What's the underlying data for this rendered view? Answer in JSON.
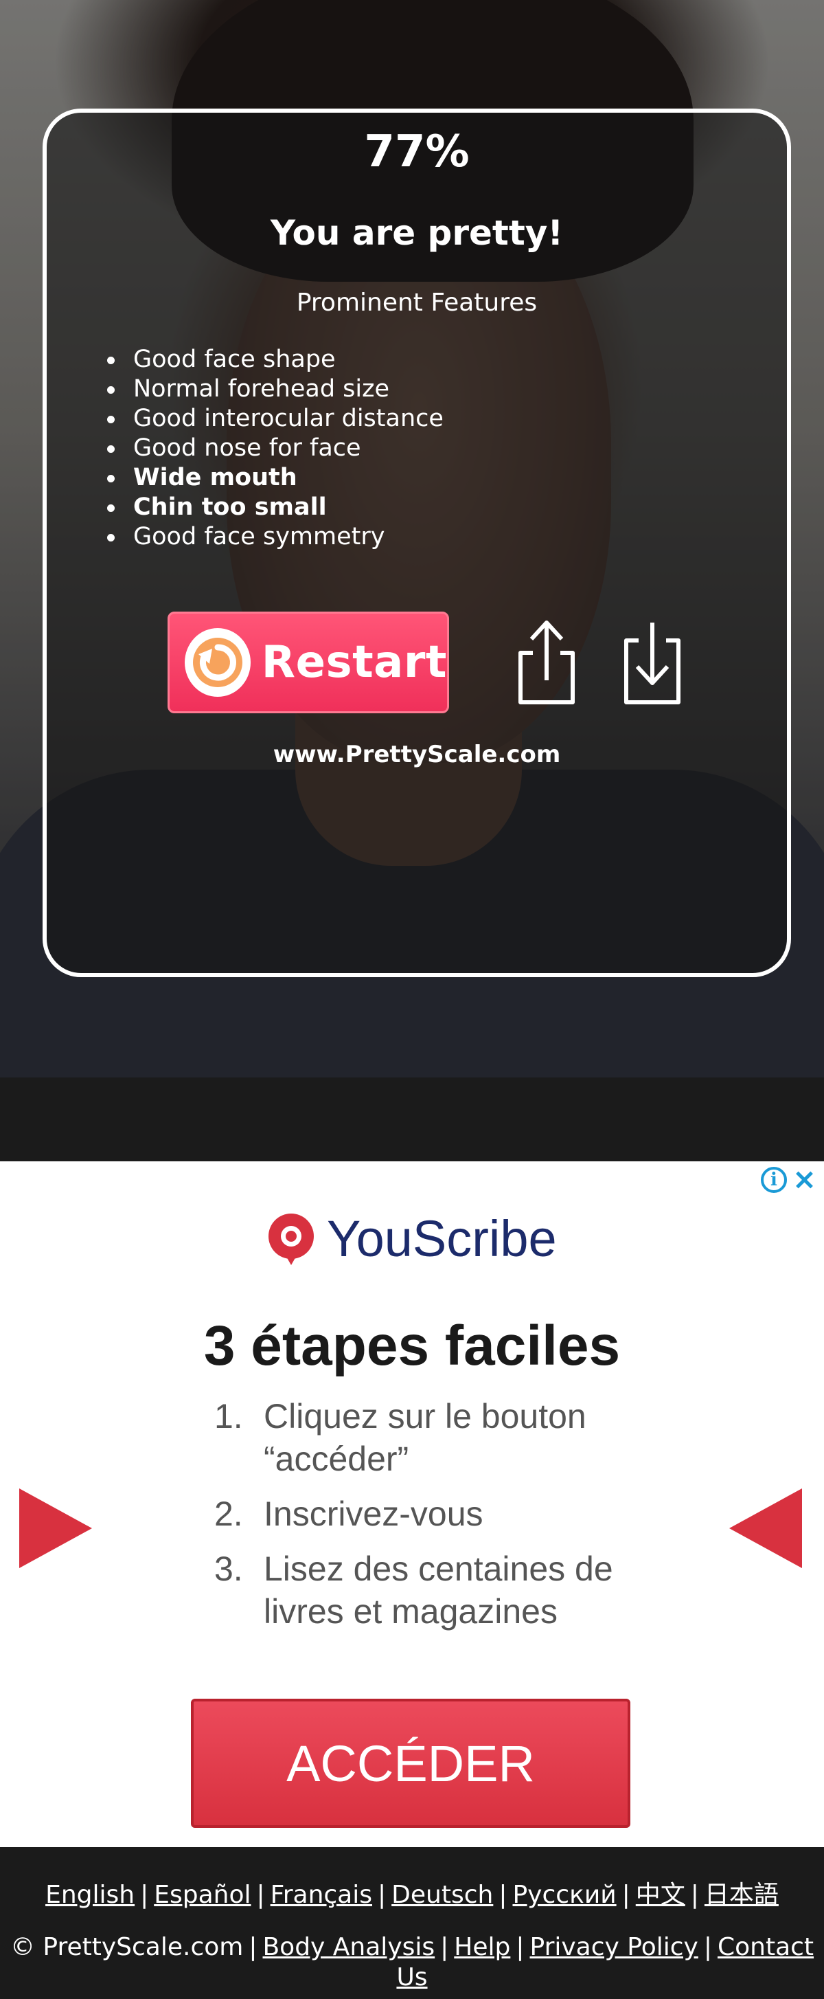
{
  "result": {
    "score": "77%",
    "verdict": "You are pretty!",
    "features_title": "Prominent Features",
    "features": [
      {
        "text": "Good face shape",
        "bold": false
      },
      {
        "text": "Normal forehead size",
        "bold": false
      },
      {
        "text": "Good interocular distance",
        "bold": false
      },
      {
        "text": "Good nose for face",
        "bold": false
      },
      {
        "text": "Wide mouth",
        "bold": true
      },
      {
        "text": "Chin too small",
        "bold": true
      },
      {
        "text": "Good face symmetry",
        "bold": false
      }
    ],
    "restart_label": "Restart",
    "share_icon": "share-icon",
    "download_icon": "download-icon",
    "site": "www.PrettyScale.com"
  },
  "ad": {
    "brand": "YouScribe",
    "headline": "3 étapes faciles",
    "steps": [
      {
        "num": "1.",
        "text": "Cliquez sur le bouton “accéder”"
      },
      {
        "num": "2.",
        "text": "Inscrivez-vous"
      },
      {
        "num": "3.",
        "text": "Lisez des centaines de livres et magazines"
      }
    ],
    "cta": "ACCÉDER",
    "info_glyph": "i",
    "accent": "#d8313f"
  },
  "footer": {
    "languages": [
      "English",
      "Español",
      "Français",
      "Deutsch",
      "Русский",
      "中文",
      "日本語"
    ],
    "copyright": "© PrettyScale.com",
    "links": [
      "Body Analysis",
      "Help",
      "Privacy Policy",
      "Contact Us"
    ]
  }
}
